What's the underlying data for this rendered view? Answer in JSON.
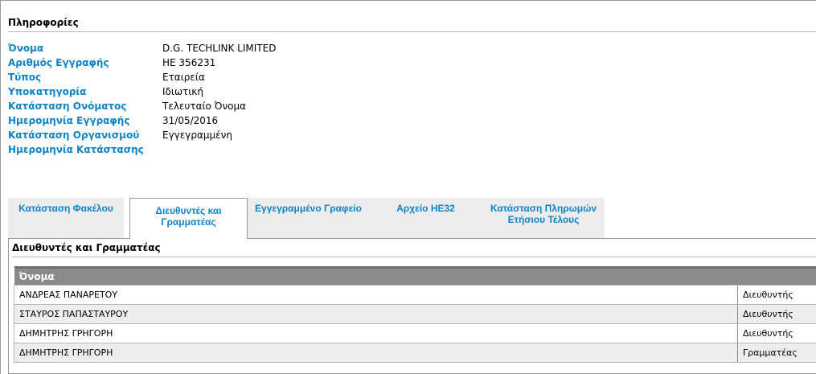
{
  "info": {
    "header": "Πληροφορίες",
    "rows": [
      {
        "label": "Όνομα",
        "value": "D.G. TECHLINK LIMITED"
      },
      {
        "label": "Αριθμός Εγγραφής",
        "value": "HE 356231"
      },
      {
        "label": "Τύπος",
        "value": "Εταιρεία"
      },
      {
        "label": "Υποκατηγορία",
        "value": "Ιδιωτική"
      },
      {
        "label": "Κατάσταση Ονόματος",
        "value": "Τελευταίο Όνομα"
      },
      {
        "label": "Ημερομηνία Εγγραφής",
        "value": "31/05/2016"
      },
      {
        "label": "Κατάσταση Οργανισμού",
        "value": "Εγγεγραμμένη"
      },
      {
        "label": "Ημερομηνία Κατάστασης",
        "value": ""
      }
    ]
  },
  "tabs": [
    {
      "label": "Κατάσταση Φακέλου",
      "active": false
    },
    {
      "label": "Διευθυντές και Γραμματέας",
      "active": true
    },
    {
      "label": "Εγγεγραμμένο Γραφείο",
      "active": false
    },
    {
      "label": "Αρχείο ΗΕ32",
      "active": false
    },
    {
      "label": "Κατάσταση Πληρωμών Ετήσιου Τέλους",
      "active": false
    }
  ],
  "panel": {
    "title": "Διευθυντές και Γραμματέας",
    "column_header": "Όνομα",
    "rows": [
      {
        "name": "ΑΝΔΡΕΑΣ ΠΑΝΑΡΕΤΟΥ",
        "role": "Διευθυντής"
      },
      {
        "name": "ΣΤΑΥΡΟΣ ΠΑΠΑΣΤΑΥΡΟΥ",
        "role": "Διευθυντής"
      },
      {
        "name": "ΔΗΜΗΤΡΗΣ ΓΡΗΓΟΡΗ",
        "role": "Διευθυντής"
      },
      {
        "name": "ΔΗΜΗΤΡΗΣ ΓΡΗΓΟΡΗ",
        "role": "Γραμματέας"
      }
    ]
  }
}
